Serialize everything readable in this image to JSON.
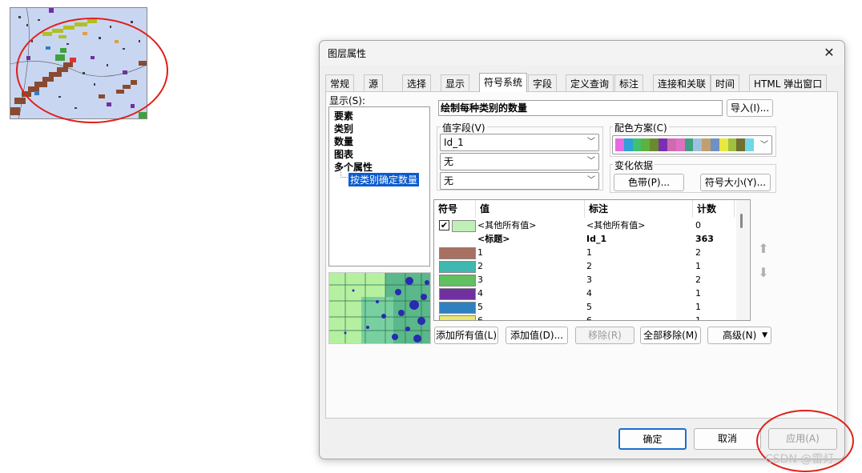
{
  "dialog": {
    "title": "图层属性",
    "close_glyph": "✕",
    "tabs": [
      "常规",
      "源",
      "选择",
      "显示",
      "符号系统",
      "字段",
      "定义查询",
      "标注",
      "连接和关联",
      "时间",
      "HTML 弹出窗口"
    ],
    "active_tab": "符号系统"
  },
  "left_panel": {
    "show_label": "显示(S):",
    "tree": [
      "要素",
      "类别",
      "数量",
      "图表",
      "多个属性"
    ],
    "tree_selected": "按类别确定数量"
  },
  "heading": "绘制每种类别的数量",
  "import_button": "导入(I)...",
  "value_fields": {
    "label": "值字段(V)",
    "field1": "Id_1",
    "field2": "无",
    "field3": "无"
  },
  "color_scheme": {
    "label": "配色方案(C)",
    "colors": [
      "#e86ae0",
      "#2fa0d8",
      "#40c070",
      "#60b040",
      "#6a8a30",
      "#7a2fb0",
      "#d06ab0",
      "#e070c0",
      "#40a080",
      "#a0c0e0",
      "#c0a070",
      "#7090c0",
      "#e8e840",
      "#a0c040",
      "#707030",
      "#70d8e8"
    ]
  },
  "variation": {
    "label": "变化依据",
    "color_ramp_button": "色带(P)...",
    "symbol_size_button": "符号大小(Y)..."
  },
  "table": {
    "headers": [
      "符号",
      "值",
      "标注",
      "计数"
    ],
    "rows": [
      {
        "symbol_color": "#c0f0b8",
        "checked": true,
        "value": "<其他所有值>",
        "label": "<其他所有值>",
        "count": "0",
        "bold": false
      },
      {
        "symbol_color": "",
        "checked": false,
        "value": "<标题>",
        "label": "Id_1",
        "count": "363",
        "bold": true
      },
      {
        "symbol_color": "#a87060",
        "checked": false,
        "value": "1",
        "label": "1",
        "count": "2",
        "bold": false
      },
      {
        "symbol_color": "#40b8b0",
        "checked": false,
        "value": "2",
        "label": "2",
        "count": "1",
        "bold": false
      },
      {
        "symbol_color": "#60c060",
        "checked": false,
        "value": "3",
        "label": "3",
        "count": "2",
        "bold": false
      },
      {
        "symbol_color": "#7030a0",
        "checked": false,
        "value": "4",
        "label": "4",
        "count": "1",
        "bold": false
      },
      {
        "symbol_color": "#3080c0",
        "checked": false,
        "value": "5",
        "label": "5",
        "count": "1",
        "bold": false
      },
      {
        "symbol_color": "#e8e870",
        "checked": false,
        "value": "6",
        "label": "6",
        "count": "1",
        "bold": false
      }
    ]
  },
  "list_buttons": {
    "add_all": "添加所有值(L)",
    "add": "添加值(D)...",
    "remove": "移除(R)",
    "remove_all": "全部移除(M)",
    "advanced": "高级(N)"
  },
  "footer": {
    "ok": "确定",
    "cancel": "取消",
    "apply": "应用(A)"
  },
  "watermark": "CSDN @雷灯"
}
